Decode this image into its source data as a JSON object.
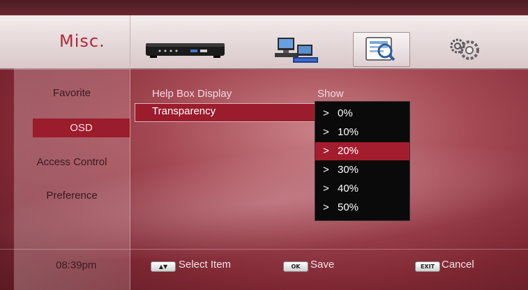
{
  "header": {
    "title": "Misc.",
    "icons": [
      "set-top-box-icon",
      "network-pc-icon",
      "misc-settings-icon",
      "gears-icon"
    ],
    "selected_icon": "misc-settings-icon"
  },
  "sidebar": {
    "items": [
      {
        "label": "Favorite"
      },
      {
        "label": "OSD",
        "selected": true
      },
      {
        "label": "Access Control"
      },
      {
        "label": "Preference"
      }
    ]
  },
  "settings": {
    "rows": [
      {
        "label": "Help Box Display",
        "value": "Show"
      },
      {
        "label": "Transparency",
        "selected": true
      }
    ]
  },
  "dropdown": {
    "arrow": ">",
    "options": [
      "0%",
      "10%",
      "20%",
      "30%",
      "40%",
      "50%"
    ],
    "highlighted": "20%"
  },
  "footer": {
    "time": "08:39pm",
    "hints": [
      {
        "key": "▲▼",
        "label": "Select Item"
      },
      {
        "key": "OK",
        "label": "Save"
      },
      {
        "key": "EXIT",
        "label": "Cancel"
      }
    ]
  },
  "colors": {
    "accent": "#9b1c2c",
    "title": "#b0283a",
    "dropdown_bg": "#0a0a0a"
  }
}
